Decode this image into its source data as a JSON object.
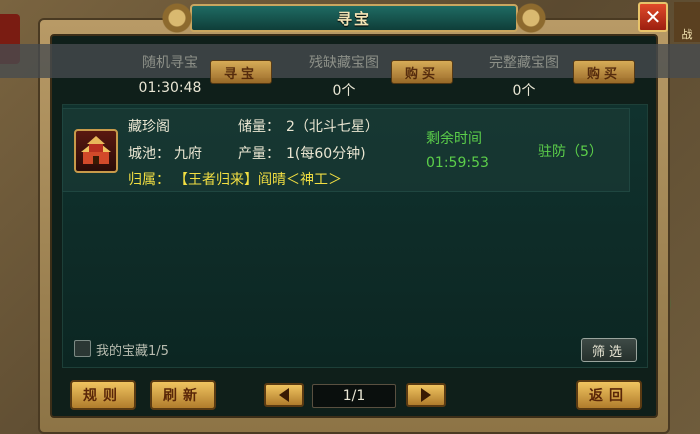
{
  "window": {
    "title": "寻宝",
    "close_symbol": "✕",
    "side_text_right": "战"
  },
  "hunts": [
    {
      "label": "随机寻宝",
      "value": "01:30:48",
      "button": "寻宝"
    },
    {
      "label": "残缺藏宝图",
      "value": "0个",
      "button": "购买"
    },
    {
      "label": "完整藏宝图",
      "value": "0个",
      "button": "购买"
    }
  ],
  "treasure": {
    "name": "藏珍阁",
    "stock_label": "储量：",
    "stock_value": "2（北斗七星）",
    "city_label": "城池：",
    "city_value": "九府",
    "output_label": "产量：",
    "output_value": "1(每60分钟)",
    "owner_label": "归属：",
    "owner_value": "【王者归来】阎晴＜神工＞",
    "remaining_label": "剩余时间",
    "remaining_value": "01:59:53",
    "garrison": "驻防（5）",
    "icon": "palace-icon"
  },
  "filters": {
    "my_treasure_label": "我的宝藏1/5",
    "filter_button": "筛选"
  },
  "footer": {
    "rules_button": "规则",
    "refresh_button": "刷新",
    "page": "1/1",
    "back_button": "返回"
  },
  "colors": {
    "accent_yellow": "#f2df42",
    "accent_green": "#5ccf4a",
    "button_gold": "#e8b85a",
    "panel_teal": "#10322e"
  }
}
